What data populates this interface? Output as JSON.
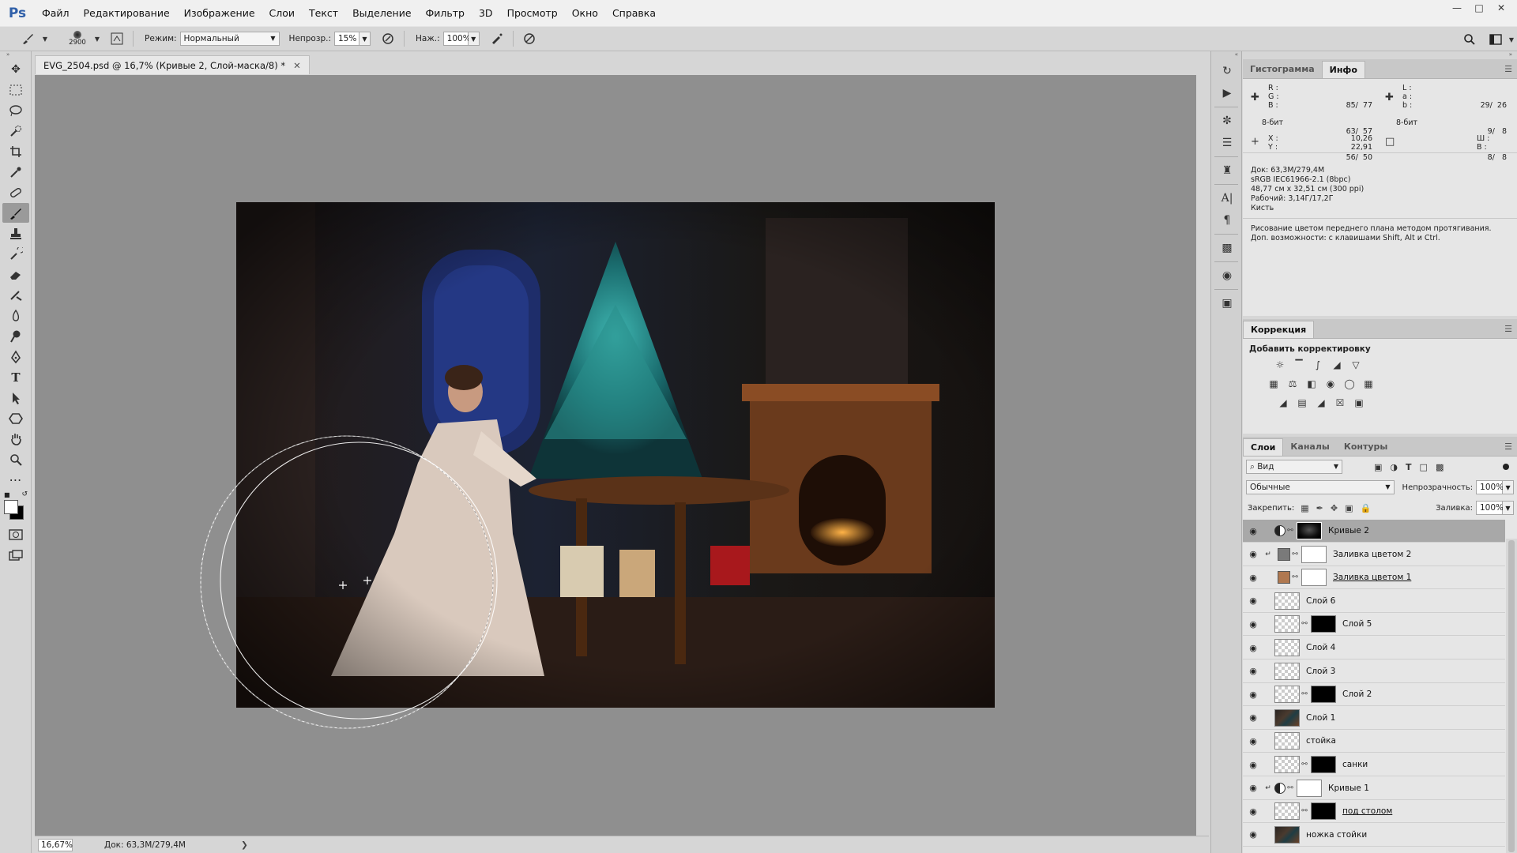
{
  "app": {
    "logo": "Ps"
  },
  "menu": [
    "Файл",
    "Редактирование",
    "Изображение",
    "Слои",
    "Текст",
    "Выделение",
    "Фильтр",
    "3D",
    "Просмотр",
    "Окно",
    "Справка"
  ],
  "options": {
    "brush_size": "2900",
    "mode_label": "Режим:",
    "mode_value": "Нормальный",
    "opacity_label": "Непрозр.:",
    "opacity_value": "15%",
    "pressure_label": "Наж.:",
    "pressure_value": "100%"
  },
  "document": {
    "tab_title": "EVG_2504.psd @ 16,7% (Кривые 2, Слой-маска/8) *",
    "zoom": "16,67%",
    "doc_size": "Док: 63,3M/279,4M"
  },
  "info_panel": {
    "tabs": [
      "Гистограмма",
      "Инфо"
    ],
    "active_tab": "Инфо",
    "rgb_labels": [
      "R :",
      "G :",
      "B :"
    ],
    "rgb_values": [
      "85/  77",
      "63/  57",
      "56/  50"
    ],
    "lab_labels": [
      "L :",
      "a :",
      "b :"
    ],
    "lab_values": [
      "29/  26",
      "9/   8",
      "8/   8"
    ],
    "bit_left": "8-бит",
    "bit_right": "8-бит",
    "xy_labels": [
      "X :",
      "Y :"
    ],
    "xy_values": [
      "10,26",
      "22,91"
    ],
    "wh_labels": [
      "Ш :",
      "В :"
    ],
    "doc_lines": [
      "Док: 63,3M/279,4M",
      "sRGB IEC61966-2.1 (8bpc)",
      "48,77 см x 32,51 см (300 ppi)",
      "Рабочий: 3,14Г/17,2Г",
      "Кисть"
    ],
    "hint": "Рисование цветом переднего плана методом протягивания. Доп. возможности: с клавишами Shift, Alt и Ctrl."
  },
  "correction_panel": {
    "tab": "Коррекция",
    "title": "Добавить корректировку"
  },
  "layers_panel": {
    "tabs": [
      "Слои",
      "Каналы",
      "Контуры"
    ],
    "active_tab": "Слои",
    "filter_value": "Вид",
    "blend_mode": "Обычные",
    "opacity_label": "Непрозрачность:",
    "opacity_value": "100%",
    "lock_label": "Закрепить:",
    "fill_label": "Заливка:",
    "fill_value": "100%",
    "layers": [
      {
        "name": "Кривые 2",
        "kind": "curves",
        "selected": true,
        "mask": "vignette"
      },
      {
        "name": "Заливка цветом 2",
        "kind": "fill",
        "clip": true,
        "swatch": "#7a7a7a",
        "mask": "white"
      },
      {
        "name": "Заливка цветом 1",
        "kind": "fill",
        "swatch": "#b07850",
        "mask": "white",
        "underline": true
      },
      {
        "name": "Слой 6",
        "kind": "empty"
      },
      {
        "name": "Слой 5",
        "kind": "empty",
        "mask": "black"
      },
      {
        "name": "Слой 4",
        "kind": "empty"
      },
      {
        "name": "Слой 3",
        "kind": "empty"
      },
      {
        "name": "Слой 2",
        "kind": "empty",
        "mask": "black"
      },
      {
        "name": "Слой 1",
        "kind": "photo"
      },
      {
        "name": "стойка",
        "kind": "empty"
      },
      {
        "name": "санки",
        "kind": "empty",
        "mask": "black"
      },
      {
        "name": "Кривые 1",
        "kind": "curves",
        "clip": true,
        "mask": "white"
      },
      {
        "name": "под столом",
        "kind": "empty",
        "mask": "black",
        "underline": true
      },
      {
        "name": "ножка стойки",
        "kind": "photo"
      }
    ]
  },
  "colors": {
    "accent_ps": "#2f5fa8",
    "canvas_bg": "#8f8f8f",
    "panel_bg": "#e6e6e6"
  }
}
